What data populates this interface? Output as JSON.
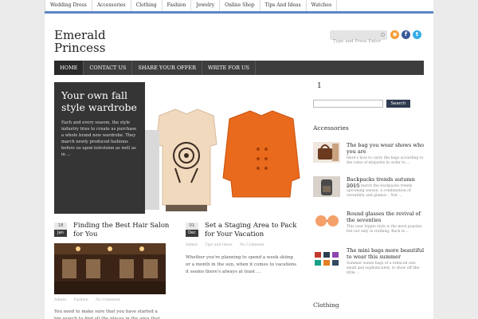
{
  "topnav": [
    "Wedding Dress",
    "Accessories",
    "Clothing",
    "Fashion",
    "Jewelry",
    "Online Shop",
    "Tips And Ideas",
    "Watches"
  ],
  "brand": {
    "line1": "Emerald",
    "line2": "Princess"
  },
  "search": {
    "placeholder": "Type and Press Enter"
  },
  "social": [
    "rss-icon",
    "facebook-icon",
    "twitter-icon"
  ],
  "nav": [
    "HOME",
    "CONTACT US",
    "SHARE YOUR OFFER",
    "WRITE FOR US"
  ],
  "featured": {
    "title": "Your own fall style wardrobe",
    "excerpt": "Each and every season, the style industry tries to create us purchase a whole brand new wardrobe. They march newly produced fashions before us upon television as well as in ..."
  },
  "posts": [
    {
      "day": "18",
      "month": "Jan",
      "title": "Finding the Best Hair Salon for You",
      "meta": [
        "Admin",
        "Fashion",
        "No Comment"
      ],
      "excerpt": "You need to make sure that you have started a big search to find all the places in the area that are going to allow ..."
    },
    {
      "day": "01",
      "month": "Dec",
      "title": "Set a Staging Area to Pack for Your Vacation",
      "meta": [
        "Admin",
        "Tips and Ideas",
        "No Comment"
      ],
      "excerpt": "Whether you're planning to spend a week skiing or a month in the sun, when it comes to vacations it seems there's always at least ..."
    }
  ],
  "sidebar": {
    "pager": "1",
    "search_button": "Search",
    "heading": "Accessories",
    "items": [
      {
        "title": "The bag you wear shows who you are",
        "excerpt": "Here's how to carry the bags according to the rules of etiquette in order to ..."
      },
      {
        "title": "Backpacks trends autumn 2015",
        "excerpt": "How to match the backpacks trends upcoming season, a combination of versatility and glamor... Not ..."
      },
      {
        "title": "Round glasses the revival of the seventies",
        "excerpt": "This year hippie style is the most popular, but not only in clothing. Back in ..."
      },
      {
        "title": "The mini bags more beautiful to wear this summer",
        "excerpt": "Summer wants bags of a reduced size small and sophisticated, to show off like little ..."
      }
    ],
    "heading2": "Clothing"
  },
  "colors": {
    "accent": "#5b86c4",
    "nav": "#3d3d3d",
    "button": "#2f3b4f"
  }
}
